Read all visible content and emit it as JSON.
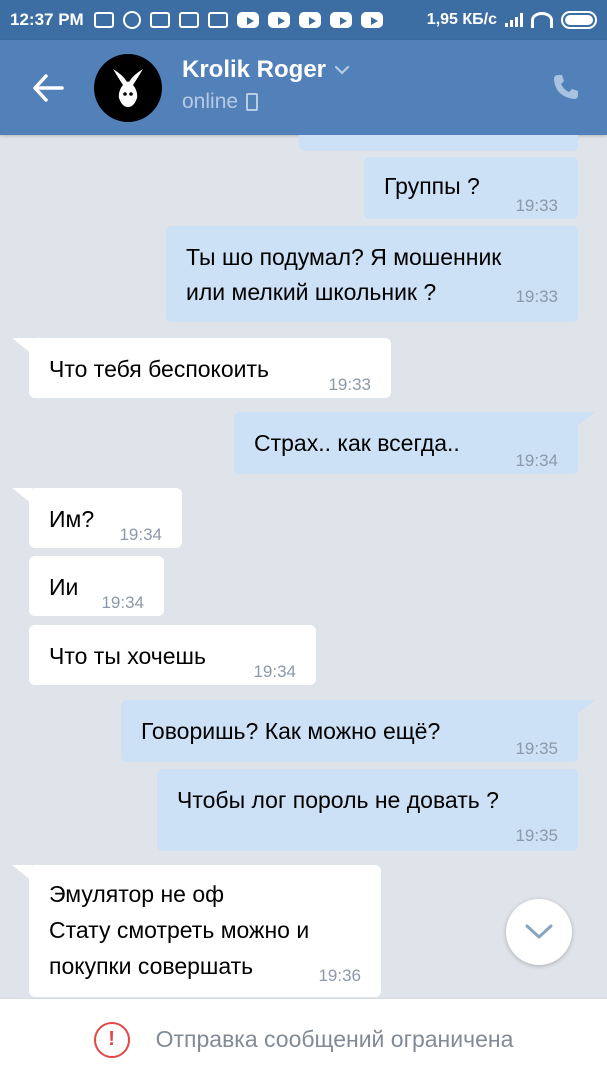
{
  "status_bar": {
    "time": "12:37 PM",
    "speed": "1,95 КБ/с",
    "icons": [
      "mail-icon",
      "chrome-icon",
      "game-icon",
      "gmail-icon",
      "instagram-icon",
      "youtube-icon",
      "youtube-icon",
      "youtube-icon",
      "youtube-icon",
      "youtube-icon",
      "signal-icon",
      "wifi-icon",
      "battery-icon"
    ]
  },
  "header": {
    "name": "Krolik Roger",
    "status": "online",
    "accent": "#5181b8"
  },
  "messages": [
    {
      "dir": "out",
      "text": "Группы ?",
      "time": "19:33"
    },
    {
      "dir": "out",
      "text": "Ты шо подумал? Я мошенник",
      "text2": "или мелкий школьник ?",
      "time": "19:33"
    },
    {
      "dir": "in",
      "text": "Что тебя беспокоить",
      "time": "19:33"
    },
    {
      "dir": "out",
      "text": "Страх.. как всегда..",
      "time": "19:34"
    },
    {
      "dir": "in",
      "text": "Им?",
      "time": "19:34"
    },
    {
      "dir": "in",
      "text": "Ии",
      "time": "19:34"
    },
    {
      "dir": "in",
      "text": "Что ты хочешь",
      "time": "19:34"
    },
    {
      "dir": "out",
      "text": "Говоришь? Как можно ещё?",
      "time": "19:35"
    },
    {
      "dir": "out",
      "text": "Чтобы лог пороль не довать ?",
      "time": "19:35"
    },
    {
      "dir": "in",
      "text": "Эмулятор не оф",
      "text2": "Стату смотреть можно и",
      "text3": "покупки совершать",
      "time": "19:36"
    }
  ],
  "footer": {
    "notice": "Отправка сообщений ограничена"
  }
}
